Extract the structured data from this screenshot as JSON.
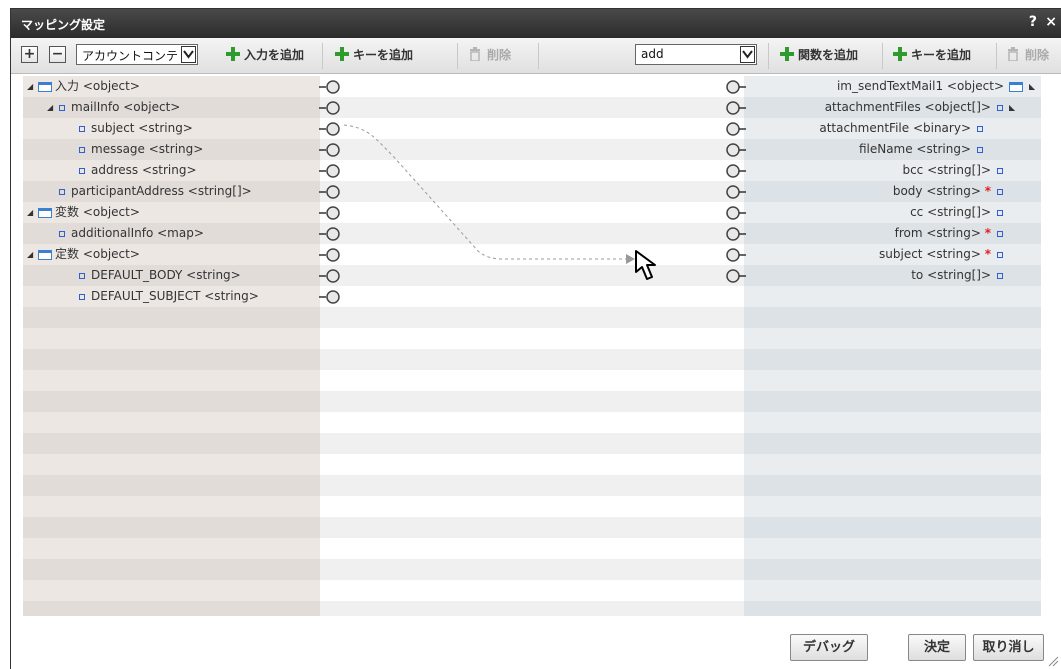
{
  "dialog": {
    "title": "マッピング設定",
    "help": "?",
    "close": "×"
  },
  "toolbar": {
    "expand_all": "+",
    "collapse_all": "−",
    "left_select_value": "アカウントコンテ",
    "add_input": "入力を追加",
    "add_key_left": "キーを追加",
    "delete_left": "削除",
    "right_select_value": "add",
    "add_function": "関数を追加",
    "add_key_right": "キーを追加",
    "delete_right": "削除"
  },
  "left_tree": [
    {
      "label": "入力 <object>",
      "type": "object",
      "expanded": true
    },
    {
      "label": "mailInfo <object>",
      "type": "leaf-expandable",
      "expanded": true
    },
    {
      "label": "subject <string>",
      "type": "leaf"
    },
    {
      "label": "message <string>",
      "type": "leaf"
    },
    {
      "label": "address <string>",
      "type": "leaf"
    },
    {
      "label": "participantAddress <string[]>",
      "type": "leaf"
    },
    {
      "label": "変数 <object>",
      "type": "object",
      "expanded": true
    },
    {
      "label": "additionalInfo <map>",
      "type": "leaf"
    },
    {
      "label": "定数 <object>",
      "type": "object",
      "expanded": true
    },
    {
      "label": "DEFAULT_BODY <string>",
      "type": "leaf"
    },
    {
      "label": "DEFAULT_SUBJECT <string>",
      "type": "leaf"
    }
  ],
  "right_tree": [
    {
      "label": "im_sendTextMail1 <object>",
      "required": false
    },
    {
      "label": "attachmentFiles <object[]>",
      "required": false
    },
    {
      "label": "attachmentFile <binary>",
      "required": false
    },
    {
      "label": "fileName <string>",
      "required": false
    },
    {
      "label": "bcc <string[]>",
      "required": false
    },
    {
      "label": "body <string>",
      "required": true
    },
    {
      "label": "cc <string[]>",
      "required": false
    },
    {
      "label": "from <string>",
      "required": true
    },
    {
      "label": "subject <string>",
      "required": true
    },
    {
      "label": "to <string[]>",
      "required": false
    }
  ],
  "required_mark": "*",
  "footer": {
    "debug": "デバッグ",
    "ok": "決定",
    "cancel": "取り消し"
  },
  "colors": {
    "left_panel_a": "#ede7e4",
    "left_panel_b": "#e2dcd9",
    "mid_a": "#ffffff",
    "mid_b": "#f0f0f0",
    "right_panel_a": "#eaedf0",
    "right_panel_b": "#dde2e6",
    "plus_green": "#2e9b2e"
  }
}
